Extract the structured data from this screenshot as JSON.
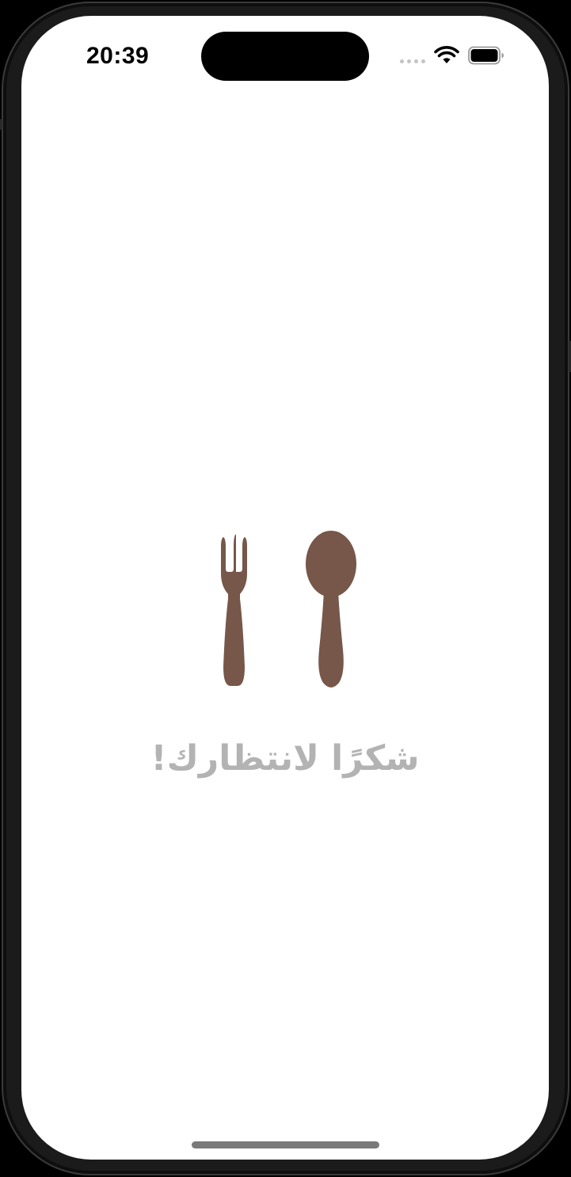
{
  "status_bar": {
    "time": "20:39",
    "icons": [
      "cellular-signal-icon",
      "wifi-icon",
      "battery-icon"
    ]
  },
  "main": {
    "illustration_icon": "fork-and-spoon-icon",
    "message": "شكرًا لانتظارك!"
  },
  "colors": {
    "icon_brown": "#76574a",
    "message_gray": "#b3b3b3",
    "screen_background": "#ffffff",
    "device_frame": "#1b1b1b"
  }
}
